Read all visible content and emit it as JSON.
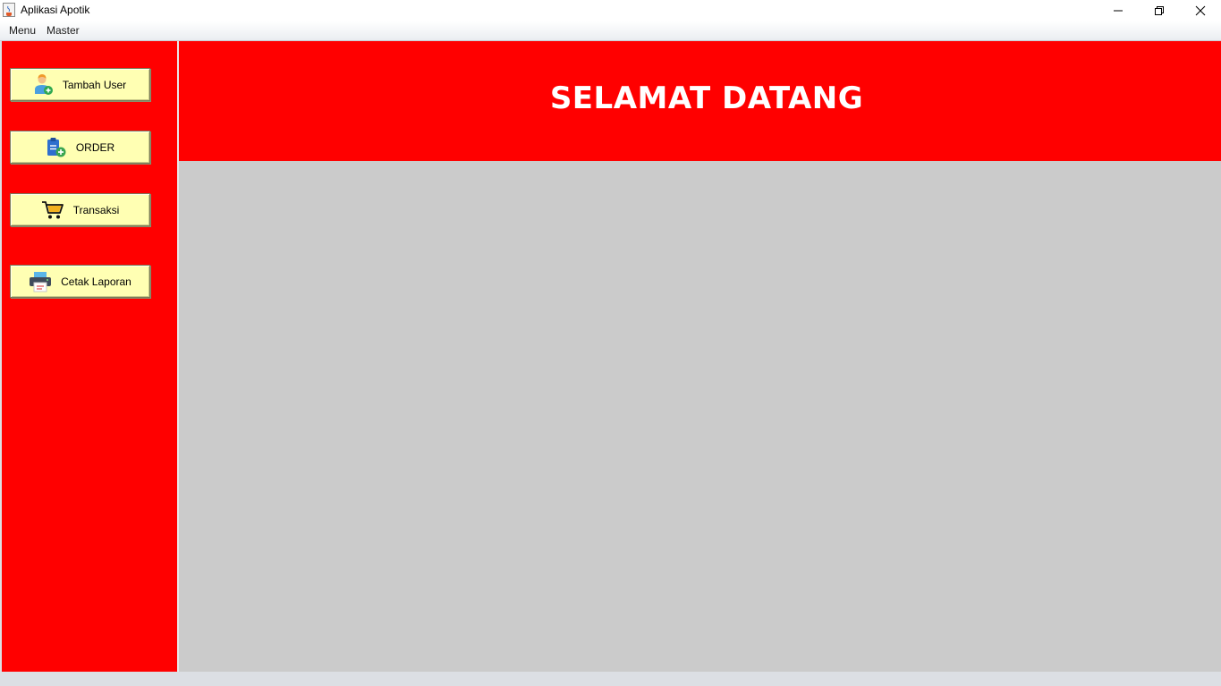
{
  "window": {
    "title": "Aplikasi Apotik",
    "app_icon": "java-cup-icon",
    "controls": [
      "minimize-icon",
      "restore-icon",
      "close-icon"
    ]
  },
  "menubar": {
    "items": [
      {
        "label": "Menu"
      },
      {
        "label": "Master"
      }
    ]
  },
  "sidebar": {
    "background": "#ff0000",
    "buttons": [
      {
        "label": "Tambah User",
        "icon": "add-user-icon"
      },
      {
        "label": "ORDER",
        "icon": "clipboard-add-icon"
      },
      {
        "label": "Transaksi",
        "icon": "shopping-cart-icon"
      },
      {
        "label": "Cetak Laporan",
        "icon": "printer-icon"
      }
    ],
    "button_color": "#ffffb3"
  },
  "header": {
    "title": "SELAMAT DATANG",
    "background": "#ff0000",
    "text_color": "#ffffff"
  },
  "content": {
    "background": "#cbcbcb"
  }
}
